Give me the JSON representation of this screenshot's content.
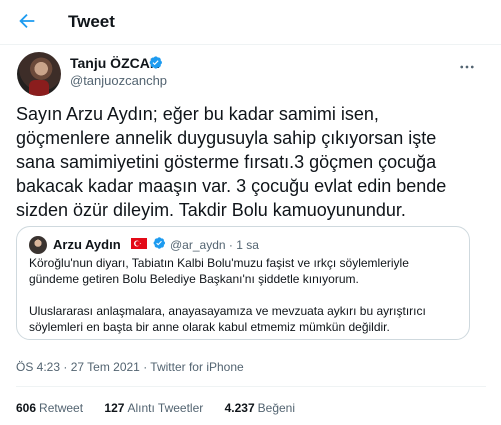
{
  "header": {
    "title": "Tweet",
    "back_icon": "arrow-left-icon"
  },
  "colors": {
    "accent": "#1d9bf0",
    "text": "#0f1419",
    "muted": "#536471",
    "border": "#cfd9de",
    "flag_red": "#e30a17"
  },
  "tweet": {
    "author_name": "Tanju ÖZCAN",
    "handle": "@tanjuozcanchp",
    "text": "Sayın Arzu Aydın; eğer bu kadar samimi isen,\ngöçmenlere annelik duygusuyla sahip çıkıyorsan işte\nsana samimiyetini gösterme fırsatı.3 göçmen çocuğa\nbakacak kadar maaşın var. 3 çocuğu evlat edin bende\nsizden özür dileyim. Takdir Bolu kamuoyunundur.",
    "timestamp": "ÖS 4:23 · 27 Tem 2021 · Twitter for iPhone"
  },
  "quote": {
    "author_name": "Arzu Aydın",
    "handle_time": "@ar_aydn · 1 sa",
    "paragraph1": "Köroğlu'nun diyarı, Tabiatın Kalbi Bolu'muzu faşist ve ırkçı söylemleriyle gündeme getiren Bolu Belediye Başkanı'nı şiddetle kınıyorum.",
    "paragraph2": "Uluslararası anlaşmalara, anayasayamıza ve mevzuata aykırı bu ayrıştırıcı söylemleri en başta bir anne olarak kabul etmemiz mümkün değildir."
  },
  "stats": {
    "retweets_count": "606",
    "retweets_label": "Retweet",
    "quotes_count": "127",
    "quotes_label": "Alıntı Tweetler",
    "likes_count": "4.237",
    "likes_label": "Beğeni"
  }
}
